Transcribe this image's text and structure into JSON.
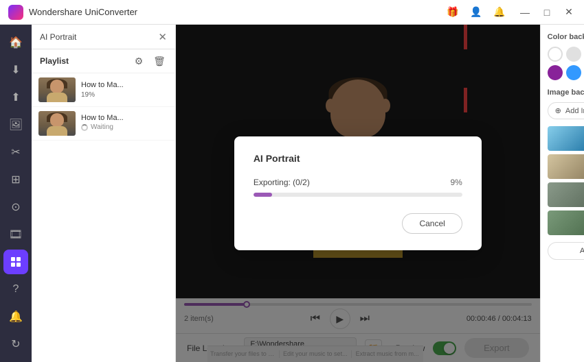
{
  "app": {
    "title": "Wondershare UniConverter",
    "logo_label": "WU"
  },
  "title_bar": {
    "buttons": {
      "minimize": "—",
      "maximize": "□",
      "close": "✕"
    },
    "icons": [
      "🎁",
      "👤",
      "🔔"
    ]
  },
  "panel_header": {
    "title": "AI Portrait",
    "close": "✕"
  },
  "playlist": {
    "title": "Playlist",
    "items": [
      {
        "name": "How to Ma...",
        "percent": "19%",
        "status": ""
      },
      {
        "name": "How to Ma...",
        "percent": "",
        "status": "Waiting"
      }
    ]
  },
  "sidebar": {
    "icons": [
      "🏠",
      "⬇",
      "⬆",
      "🖼",
      "✂",
      "⊞",
      "⊙",
      "🎞",
      "⚙",
      "⋮⋮"
    ]
  },
  "controls": {
    "items_count": "2 item(s)",
    "time_current": "00:00:46",
    "time_total": "00:04:13",
    "time_separator": " / "
  },
  "bottom_bar": {
    "file_location_label": "File Location:",
    "file_path": "F:\\Wondershare UniConverter",
    "preview_label": "Preview",
    "export_label": "Export"
  },
  "right_panel": {
    "color_bg_title": "Color background:",
    "image_bg_title": "Image background:",
    "add_image_label": "Add Image",
    "apply_all_label": "Apply to All",
    "colors": [
      {
        "value": "#ffffff",
        "label": "white"
      },
      {
        "value": "#f0f0f0",
        "label": "light-gray"
      },
      {
        "value": "#2d2d2d",
        "label": "dark",
        "selected": true
      },
      {
        "value": "#e84040",
        "label": "red"
      },
      {
        "value": "#cc2266",
        "label": "pink-red"
      },
      {
        "value": "#882299",
        "label": "purple"
      },
      {
        "value": "#3399ff",
        "label": "blue"
      },
      {
        "value": "#44aa44",
        "label": "green"
      },
      {
        "value": "#ffaa00",
        "label": "orange"
      },
      {
        "value": "#ff66cc",
        "label": "light-pink"
      }
    ]
  },
  "modal": {
    "title": "AI Portrait",
    "status_text": "Exporting: (0/2)",
    "percent": "9%",
    "progress": 9,
    "cancel_label": "Cancel"
  },
  "footer_hints": [
    "Transfer your files to device or hard drive.",
    "Edit your music to set...",
    "Extract music from m..."
  ]
}
